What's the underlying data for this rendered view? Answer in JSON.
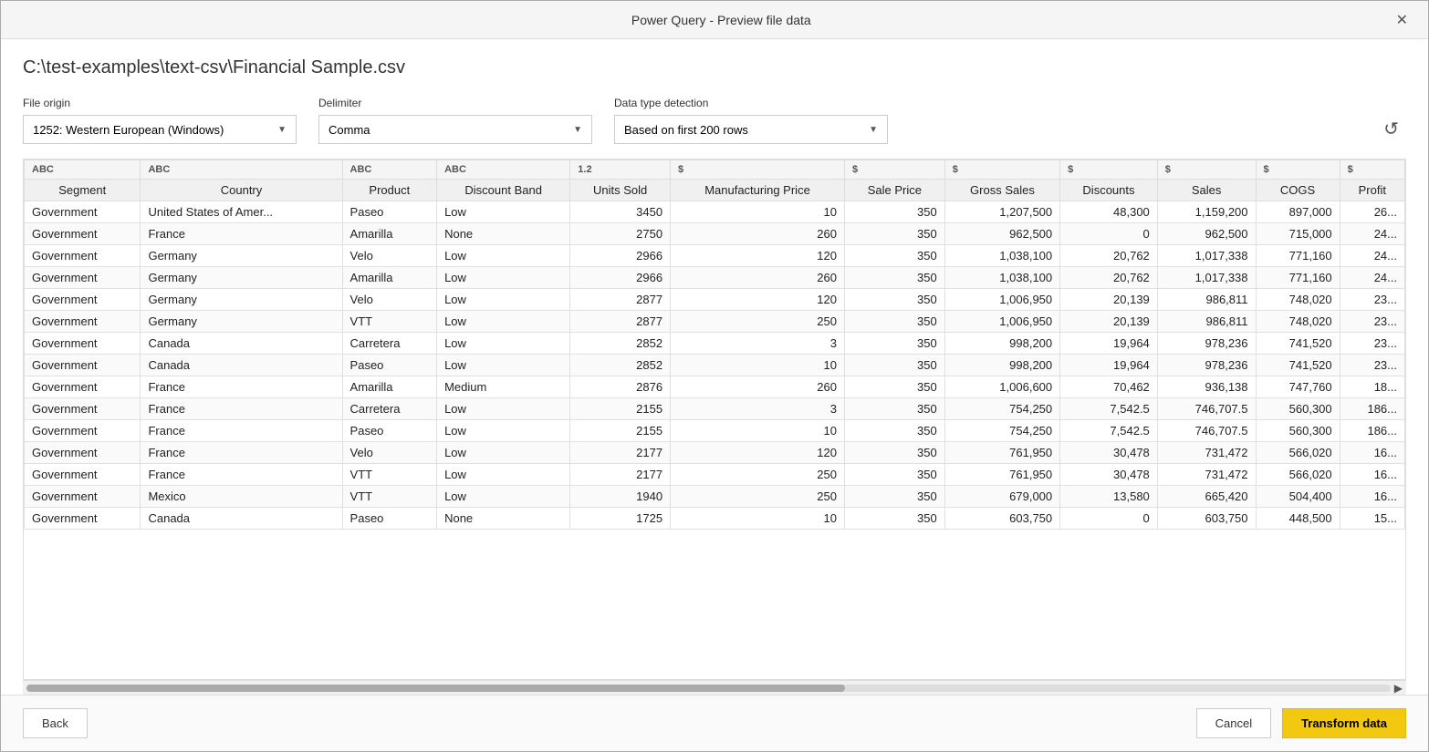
{
  "title": "Power Query - Preview file data",
  "file_path": "C:\\test-examples\\text-csv\\Financial Sample.csv",
  "close_label": "✕",
  "controls": {
    "file_origin": {
      "label": "File origin",
      "value": "1252: Western European (Windows)",
      "options": [
        "1252: Western European (Windows)"
      ]
    },
    "delimiter": {
      "label": "Delimiter",
      "value": "Comma",
      "options": [
        "Comma"
      ]
    },
    "data_type": {
      "label": "Data type detection",
      "value": "Based on first 200 rows",
      "options": [
        "Based on first 200 rows"
      ]
    }
  },
  "columns": [
    {
      "name": "Segment",
      "type": "ABC",
      "type_label": "ABC"
    },
    {
      "name": "Country",
      "type": "ABC",
      "type_label": "ABC"
    },
    {
      "name": "Product",
      "type": "ABC",
      "type_label": "ABC"
    },
    {
      "name": "Discount Band",
      "type": "ABC",
      "type_label": "ABC"
    },
    {
      "name": "Units Sold",
      "type": "1.2",
      "type_label": "1.2"
    },
    {
      "name": "Manufacturing Price",
      "type": "$",
      "type_label": "$"
    },
    {
      "name": "Sale Price",
      "type": "$",
      "type_label": "$"
    },
    {
      "name": "Gross Sales",
      "type": "$",
      "type_label": "$"
    },
    {
      "name": "Discounts",
      "type": "$",
      "type_label": "$"
    },
    {
      "name": "Sales",
      "type": "$",
      "type_label": "$"
    },
    {
      "name": "COGS",
      "type": "$",
      "type_label": "$"
    },
    {
      "name": "Profit",
      "type": "$",
      "type_label": "$"
    }
  ],
  "rows": [
    [
      "Government",
      "United States of Amer...",
      "Paseo",
      "Low",
      "3450",
      "10",
      "350",
      "1,207,500",
      "48,300",
      "1,159,200",
      "897,000",
      "26..."
    ],
    [
      "Government",
      "France",
      "Amarilla",
      "None",
      "2750",
      "260",
      "350",
      "962,500",
      "0",
      "962,500",
      "715,000",
      "24..."
    ],
    [
      "Government",
      "Germany",
      "Velo",
      "Low",
      "2966",
      "120",
      "350",
      "1,038,100",
      "20,762",
      "1,017,338",
      "771,160",
      "24..."
    ],
    [
      "Government",
      "Germany",
      "Amarilla",
      "Low",
      "2966",
      "260",
      "350",
      "1,038,100",
      "20,762",
      "1,017,338",
      "771,160",
      "24..."
    ],
    [
      "Government",
      "Germany",
      "Velo",
      "Low",
      "2877",
      "120",
      "350",
      "1,006,950",
      "20,139",
      "986,811",
      "748,020",
      "23..."
    ],
    [
      "Government",
      "Germany",
      "VTT",
      "Low",
      "2877",
      "250",
      "350",
      "1,006,950",
      "20,139",
      "986,811",
      "748,020",
      "23..."
    ],
    [
      "Government",
      "Canada",
      "Carretera",
      "Low",
      "2852",
      "3",
      "350",
      "998,200",
      "19,964",
      "978,236",
      "741,520",
      "23..."
    ],
    [
      "Government",
      "Canada",
      "Paseo",
      "Low",
      "2852",
      "10",
      "350",
      "998,200",
      "19,964",
      "978,236",
      "741,520",
      "23..."
    ],
    [
      "Government",
      "France",
      "Amarilla",
      "Medium",
      "2876",
      "260",
      "350",
      "1,006,600",
      "70,462",
      "936,138",
      "747,760",
      "18..."
    ],
    [
      "Government",
      "France",
      "Carretera",
      "Low",
      "2155",
      "3",
      "350",
      "754,250",
      "7,542.5",
      "746,707.5",
      "560,300",
      "186..."
    ],
    [
      "Government",
      "France",
      "Paseo",
      "Low",
      "2155",
      "10",
      "350",
      "754,250",
      "7,542.5",
      "746,707.5",
      "560,300",
      "186..."
    ],
    [
      "Government",
      "France",
      "Velo",
      "Low",
      "2177",
      "120",
      "350",
      "761,950",
      "30,478",
      "731,472",
      "566,020",
      "16..."
    ],
    [
      "Government",
      "France",
      "VTT",
      "Low",
      "2177",
      "250",
      "350",
      "761,950",
      "30,478",
      "731,472",
      "566,020",
      "16..."
    ],
    [
      "Government",
      "Mexico",
      "VTT",
      "Low",
      "1940",
      "250",
      "350",
      "679,000",
      "13,580",
      "665,420",
      "504,400",
      "16..."
    ],
    [
      "Government",
      "Canada",
      "Paseo",
      "None",
      "1725",
      "10",
      "350",
      "603,750",
      "0",
      "603,750",
      "448,500",
      "15..."
    ]
  ],
  "footer": {
    "back_label": "Back",
    "cancel_label": "Cancel",
    "transform_label": "Transform data"
  }
}
